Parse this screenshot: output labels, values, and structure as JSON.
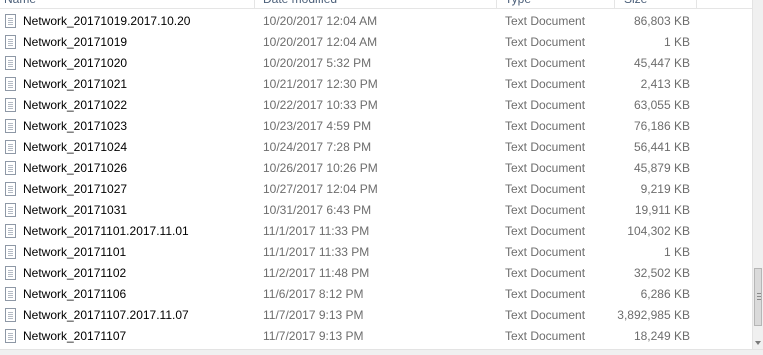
{
  "columns": {
    "name": "Name",
    "date": "Date modified",
    "type": "Type",
    "size": "Size"
  },
  "files": [
    {
      "name": "Network_20171019.2017.10.20",
      "date": "10/20/2017 12:04 AM",
      "type": "Text Document",
      "size": "86,803 KB",
      "icon": "text-file-icon"
    },
    {
      "name": "Network_20171019",
      "date": "10/20/2017 12:04 AM",
      "type": "Text Document",
      "size": "1 KB",
      "icon": "text-file-icon"
    },
    {
      "name": "Network_20171020",
      "date": "10/20/2017 5:32 PM",
      "type": "Text Document",
      "size": "45,447 KB",
      "icon": "text-file-icon"
    },
    {
      "name": "Network_20171021",
      "date": "10/21/2017 12:30 PM",
      "type": "Text Document",
      "size": "2,413 KB",
      "icon": "text-file-icon"
    },
    {
      "name": "Network_20171022",
      "date": "10/22/2017 10:33 PM",
      "type": "Text Document",
      "size": "63,055 KB",
      "icon": "text-file-icon"
    },
    {
      "name": "Network_20171023",
      "date": "10/23/2017 4:59 PM",
      "type": "Text Document",
      "size": "76,186 KB",
      "icon": "text-file-icon"
    },
    {
      "name": "Network_20171024",
      "date": "10/24/2017 7:28 PM",
      "type": "Text Document",
      "size": "56,441 KB",
      "icon": "text-file-icon"
    },
    {
      "name": "Network_20171026",
      "date": "10/26/2017 10:26 PM",
      "type": "Text Document",
      "size": "45,879 KB",
      "icon": "text-file-icon"
    },
    {
      "name": "Network_20171027",
      "date": "10/27/2017 12:04 PM",
      "type": "Text Document",
      "size": "9,219 KB",
      "icon": "text-file-icon"
    },
    {
      "name": "Network_20171031",
      "date": "10/31/2017 6:43 PM",
      "type": "Text Document",
      "size": "19,911 KB",
      "icon": "text-file-icon"
    },
    {
      "name": "Network_20171101.2017.11.01",
      "date": "11/1/2017 11:33 PM",
      "type": "Text Document",
      "size": "104,302 KB",
      "icon": "text-file-icon"
    },
    {
      "name": "Network_20171101",
      "date": "11/1/2017 11:33 PM",
      "type": "Text Document",
      "size": "1 KB",
      "icon": "text-file-icon"
    },
    {
      "name": "Network_20171102",
      "date": "11/2/2017 11:48 PM",
      "type": "Text Document",
      "size": "32,502 KB",
      "icon": "text-file-icon"
    },
    {
      "name": "Network_20171106",
      "date": "11/6/2017 8:12 PM",
      "type": "Text Document",
      "size": "6,286 KB",
      "icon": "text-file-icon"
    },
    {
      "name": "Network_20171107.2017.11.07",
      "date": "11/7/2017 9:13 PM",
      "type": "Text Document",
      "size": "3,892,985 KB",
      "icon": "text-file-icon"
    },
    {
      "name": "Network_20171107",
      "date": "11/7/2017 9:13 PM",
      "type": "Text Document",
      "size": "18,249 KB",
      "icon": "text-file-icon"
    }
  ],
  "colors": {
    "header_text": "#4c607a",
    "name_text": "#000000",
    "detail_text": "#6d6d6d"
  }
}
